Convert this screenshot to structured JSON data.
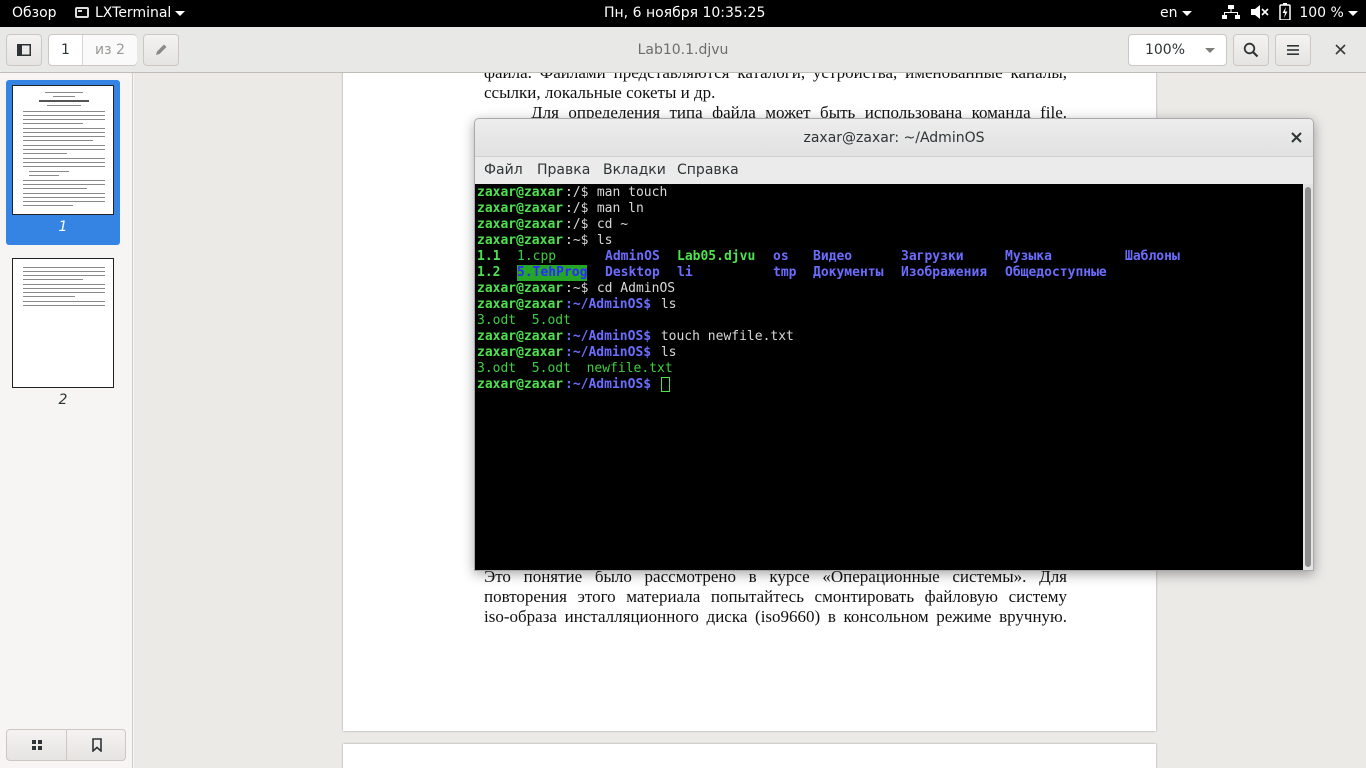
{
  "topbar": {
    "activities": "Обзор",
    "app_menu": "LXTerminal",
    "clock": "Пн, 6 ноября  10:35:25",
    "keyboard_layout": "en",
    "battery": "100 %"
  },
  "viewer": {
    "page_current": "1",
    "page_total": "из 2",
    "title": "Lab10.1.djvu",
    "zoom": "100%",
    "thumbnail_labels": [
      "1",
      "2"
    ],
    "selected_page": 1
  },
  "document": {
    "top_lines": [
      "файла. Файлами представляются каталоги, устройства, именованные каналы,",
      "ссылки, локальные сокеты и др.",
      "Для определения типа файла может быть использована команда file."
    ],
    "bottom_lines": [
      "Это понятие было рассмотрено в курсе «Операционные системы». Для",
      "повторения этого материала попытайтесь смонтировать файловую систему",
      "iso-образа инсталляционного диска (iso9660) в консольном режиме вручную."
    ]
  },
  "terminal": {
    "title": "zaxar@zaxar: ~/AdminOS",
    "menu": [
      "Файл",
      "Правка",
      "Вкладки",
      "Справка"
    ],
    "prompt_user": "zaxar@zaxar",
    "lines": {
      "l1": {
        "path": ":/$",
        "cmd": " man touch"
      },
      "l2": {
        "path": ":/$",
        "cmd": " man ln"
      },
      "l3": {
        "path": ":/$",
        "cmd": " cd ~"
      },
      "l4": {
        "path": ":~$",
        "cmd": " ls"
      },
      "l5": [
        "1.1",
        "1.cpp",
        "AdminOS",
        "Lab05.djvu",
        "os",
        "Видео",
        "Загрузки",
        "Музыка",
        "Шаблоны"
      ],
      "l6": [
        "1.2",
        "5.TehProg",
        "Desktop",
        "li",
        "tmp",
        "Документы",
        "Изображения",
        "Общедоступные"
      ],
      "l7": {
        "path": ":~$",
        "cmd": " cd AdminOS"
      },
      "l8": {
        "path": ":~/AdminOS$",
        "cmd": " ls"
      },
      "l9": "3.odt  5.odt",
      "l10": {
        "path": ":~/AdminOS$",
        "cmd": " touch newfile.txt"
      },
      "l11": {
        "path": ":~/AdminOS$",
        "cmd": " ls"
      },
      "l12": "3.odt  5.odt  newfile.txt",
      "l13": {
        "path": ":~/AdminOS$",
        "cmd": " "
      }
    }
  }
}
